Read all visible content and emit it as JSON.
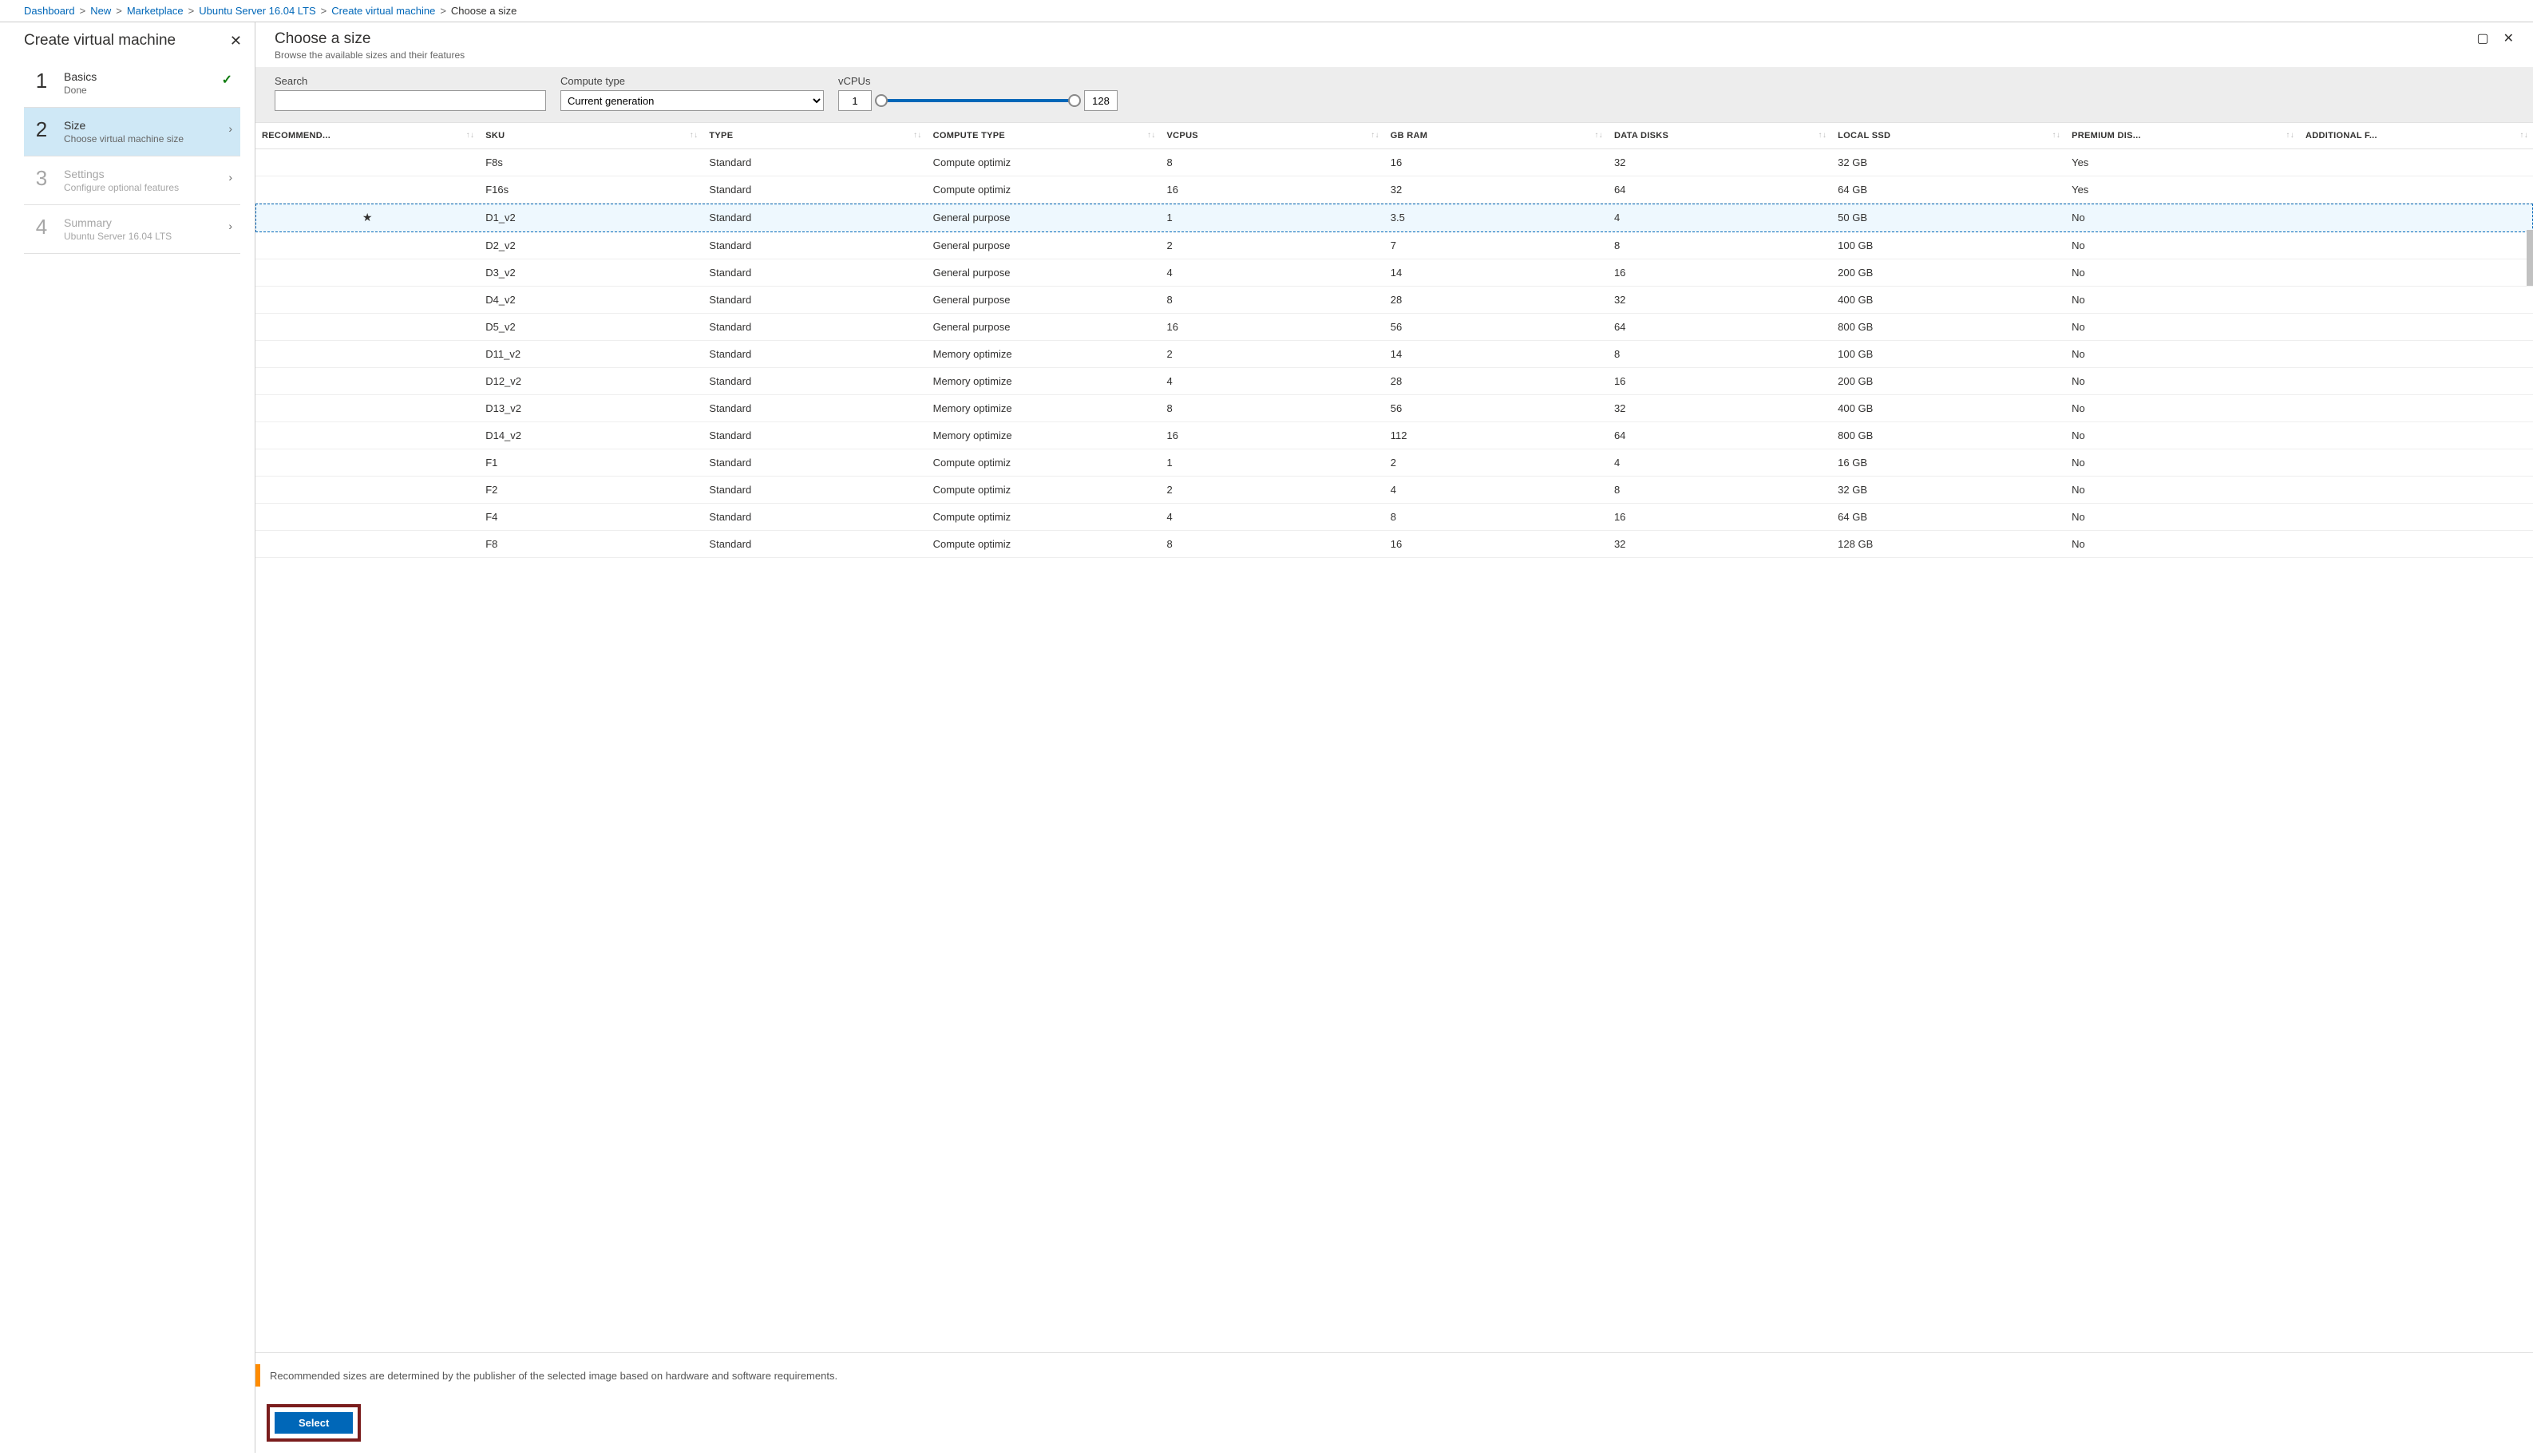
{
  "breadcrumb": {
    "items": [
      "Dashboard",
      "New",
      "Marketplace",
      "Ubuntu Server 16.04 LTS",
      "Create virtual machine"
    ],
    "current": "Choose a size"
  },
  "wizard": {
    "title": "Create virtual machine",
    "steps": [
      {
        "num": "1",
        "title": "Basics",
        "sub": "Done",
        "state": "done"
      },
      {
        "num": "2",
        "title": "Size",
        "sub": "Choose virtual machine size",
        "state": "active"
      },
      {
        "num": "3",
        "title": "Settings",
        "sub": "Configure optional features",
        "state": "future"
      },
      {
        "num": "4",
        "title": "Summary",
        "sub": "Ubuntu Server 16.04 LTS",
        "state": "future"
      }
    ]
  },
  "blade": {
    "title": "Choose a size",
    "subtitle": "Browse the available sizes and their features"
  },
  "filters": {
    "search_label": "Search",
    "search_value": "",
    "compute_label": "Compute type",
    "compute_value": "Current generation",
    "vcpu_label": "vCPUs",
    "vcpu_min": "1",
    "vcpu_max": "128"
  },
  "columns": [
    "RECOMMEND...",
    "SKU",
    "TYPE",
    "COMPUTE TYPE",
    "VCPUS",
    "GB RAM",
    "DATA DISKS",
    "LOCAL SSD",
    "PREMIUM DIS...",
    "ADDITIONAL F..."
  ],
  "rows": [
    {
      "rec": "",
      "sku": "F8s",
      "type": "Standard",
      "ctype": "Compute optimiz",
      "vcpus": "8",
      "ram": "16",
      "disks": "32",
      "ssd": "32 GB",
      "prem": "Yes",
      "add": ""
    },
    {
      "rec": "",
      "sku": "F16s",
      "type": "Standard",
      "ctype": "Compute optimiz",
      "vcpus": "16",
      "ram": "32",
      "disks": "64",
      "ssd": "64 GB",
      "prem": "Yes",
      "add": ""
    },
    {
      "rec": "★",
      "sku": "D1_v2",
      "type": "Standard",
      "ctype": "General purpose",
      "vcpus": "1",
      "ram": "3.5",
      "disks": "4",
      "ssd": "50 GB",
      "prem": "No",
      "add": "",
      "selected": true
    },
    {
      "rec": "",
      "sku": "D2_v2",
      "type": "Standard",
      "ctype": "General purpose",
      "vcpus": "2",
      "ram": "7",
      "disks": "8",
      "ssd": "100 GB",
      "prem": "No",
      "add": ""
    },
    {
      "rec": "",
      "sku": "D3_v2",
      "type": "Standard",
      "ctype": "General purpose",
      "vcpus": "4",
      "ram": "14",
      "disks": "16",
      "ssd": "200 GB",
      "prem": "No",
      "add": ""
    },
    {
      "rec": "",
      "sku": "D4_v2",
      "type": "Standard",
      "ctype": "General purpose",
      "vcpus": "8",
      "ram": "28",
      "disks": "32",
      "ssd": "400 GB",
      "prem": "No",
      "add": ""
    },
    {
      "rec": "",
      "sku": "D5_v2",
      "type": "Standard",
      "ctype": "General purpose",
      "vcpus": "16",
      "ram": "56",
      "disks": "64",
      "ssd": "800 GB",
      "prem": "No",
      "add": ""
    },
    {
      "rec": "",
      "sku": "D11_v2",
      "type": "Standard",
      "ctype": "Memory optimize",
      "vcpus": "2",
      "ram": "14",
      "disks": "8",
      "ssd": "100 GB",
      "prem": "No",
      "add": ""
    },
    {
      "rec": "",
      "sku": "D12_v2",
      "type": "Standard",
      "ctype": "Memory optimize",
      "vcpus": "4",
      "ram": "28",
      "disks": "16",
      "ssd": "200 GB",
      "prem": "No",
      "add": ""
    },
    {
      "rec": "",
      "sku": "D13_v2",
      "type": "Standard",
      "ctype": "Memory optimize",
      "vcpus": "8",
      "ram": "56",
      "disks": "32",
      "ssd": "400 GB",
      "prem": "No",
      "add": ""
    },
    {
      "rec": "",
      "sku": "D14_v2",
      "type": "Standard",
      "ctype": "Memory optimize",
      "vcpus": "16",
      "ram": "112",
      "disks": "64",
      "ssd": "800 GB",
      "prem": "No",
      "add": ""
    },
    {
      "rec": "",
      "sku": "F1",
      "type": "Standard",
      "ctype": "Compute optimiz",
      "vcpus": "1",
      "ram": "2",
      "disks": "4",
      "ssd": "16 GB",
      "prem": "No",
      "add": ""
    },
    {
      "rec": "",
      "sku": "F2",
      "type": "Standard",
      "ctype": "Compute optimiz",
      "vcpus": "2",
      "ram": "4",
      "disks": "8",
      "ssd": "32 GB",
      "prem": "No",
      "add": ""
    },
    {
      "rec": "",
      "sku": "F4",
      "type": "Standard",
      "ctype": "Compute optimiz",
      "vcpus": "4",
      "ram": "8",
      "disks": "16",
      "ssd": "64 GB",
      "prem": "No",
      "add": ""
    },
    {
      "rec": "",
      "sku": "F8",
      "type": "Standard",
      "ctype": "Compute optimiz",
      "vcpus": "8",
      "ram": "16",
      "disks": "32",
      "ssd": "128 GB",
      "prem": "No",
      "add": ""
    }
  ],
  "info": "Recommended sizes are determined by the publisher of the selected image based on hardware and software requirements.",
  "select_label": "Select"
}
